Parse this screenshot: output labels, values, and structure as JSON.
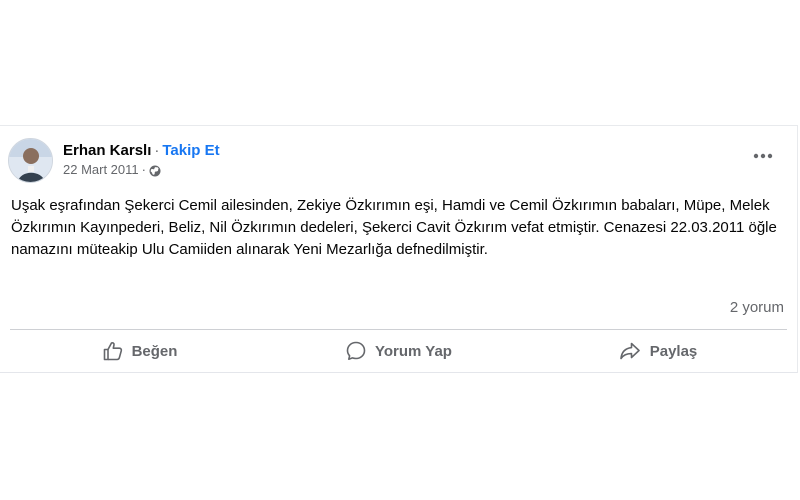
{
  "post": {
    "author": "Erhan Karslı",
    "separator": "·",
    "follow_label": "Takip Et",
    "date": "22 Mart 2011",
    "date_separator": "·",
    "privacy_icon": "globe-icon",
    "text": "Uşak eşrafından Şekerci Cemil ailesinden, Zekiye Özkırımın eşi, Hamdi ve Cemil Özkırımın babaları, Müpe, Melek Özkırımın Kayınpederi, Beliz, Nil Özkırımın dedeleri, Şekerci Cavit Özkırım vefat etmiştir. Cenazesi 22.03.2011 öğle namazını müteakip Ulu Camiiden alınarak Yeni Mezarlığa defnedilmiştir.",
    "comment_count": "2 yorum",
    "more_icon": "more-options-icon"
  },
  "actions": {
    "like_label": "Beğen",
    "comment_label": "Yorum Yap",
    "share_label": "Paylaş"
  },
  "colors": {
    "link": "#1877f2",
    "text_primary": "#050505",
    "text_secondary": "#65676b",
    "divider": "#ced0d4"
  }
}
